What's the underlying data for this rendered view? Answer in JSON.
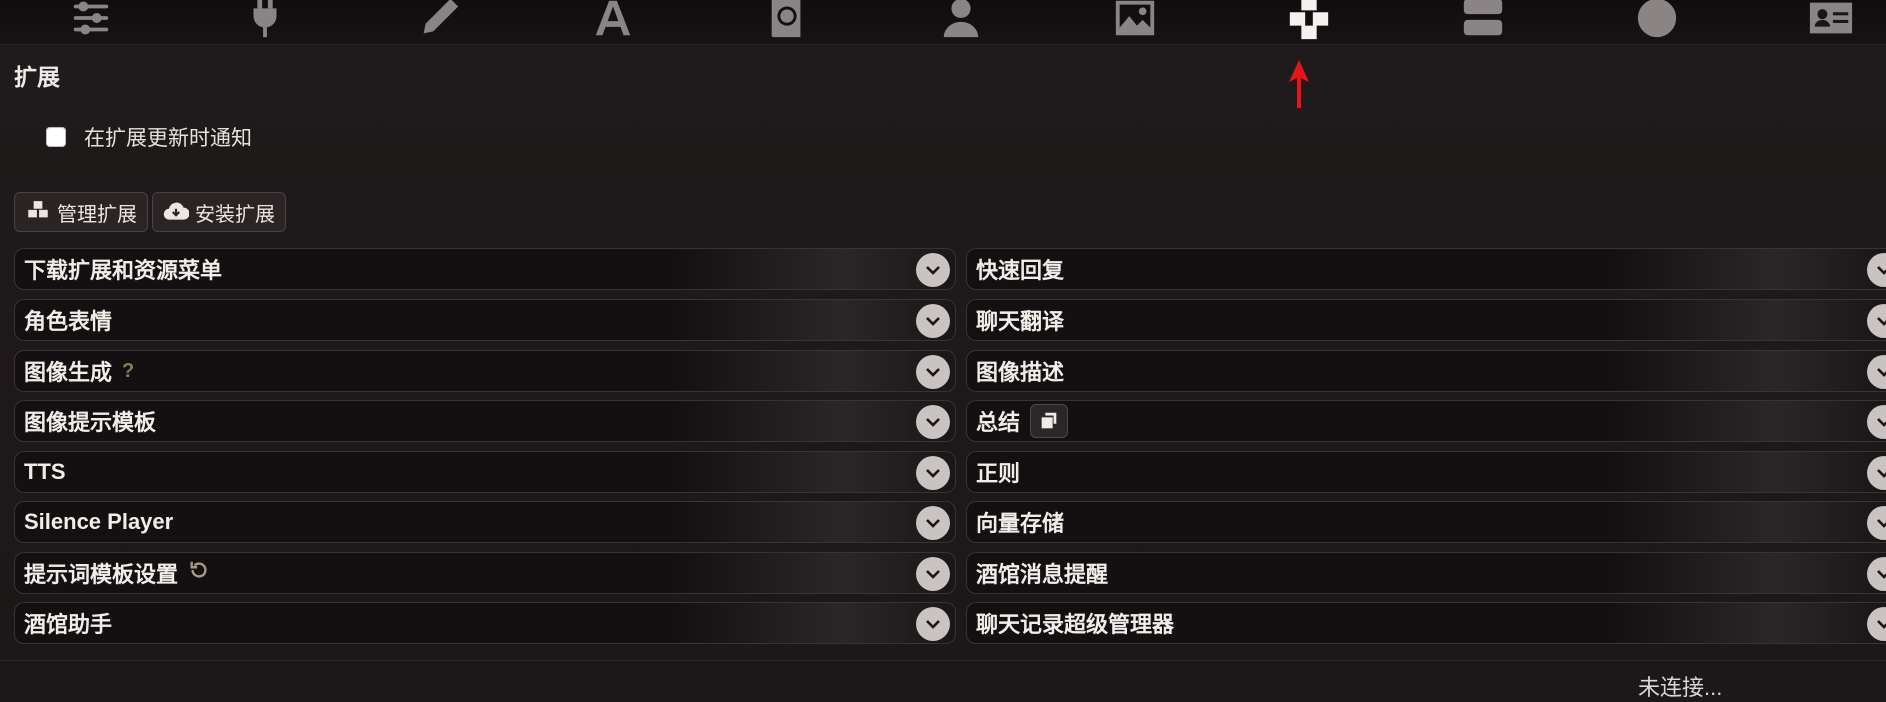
{
  "topbar": {
    "icons": [
      {
        "name": "sliders-icon"
      },
      {
        "name": "plug-icon"
      },
      {
        "name": "pencil-icon"
      },
      {
        "name": "font-icon"
      },
      {
        "name": "globe-book-icon"
      },
      {
        "name": "user-icon"
      },
      {
        "name": "image-icon"
      },
      {
        "name": "cubes-icon",
        "active": true
      },
      {
        "name": "server-icon"
      },
      {
        "name": "smile-icon"
      },
      {
        "name": "id-card-icon"
      }
    ],
    "active_color": "#f4f1ee",
    "inactive_color": "#8a8584",
    "pointer_color": "#e8141a"
  },
  "panel": {
    "title": "扩展",
    "notify_label": "在扩展更新时通知",
    "notify_checked": false,
    "buttons": {
      "manage": "管理扩展",
      "install": "安装扩展"
    }
  },
  "extensions": {
    "left": [
      {
        "label": "下载扩展和资源菜单"
      },
      {
        "label": "角色表情"
      },
      {
        "label": "图像生成",
        "help": "?"
      },
      {
        "label": "图像提示模板"
      },
      {
        "label": "TTS"
      },
      {
        "label": "Silence Player"
      },
      {
        "label": "提示词模板设置"
      },
      {
        "label": "酒馆助手"
      }
    ],
    "right": [
      {
        "label": "快速回复"
      },
      {
        "label": "聊天翻译"
      },
      {
        "label": "图像描述"
      },
      {
        "label": "总结"
      },
      {
        "label": "正则"
      },
      {
        "label": "向量存储"
      },
      {
        "label": "酒馆消息提醒"
      },
      {
        "label": "聊天记录超级管理器"
      }
    ]
  },
  "status": "未连接..."
}
